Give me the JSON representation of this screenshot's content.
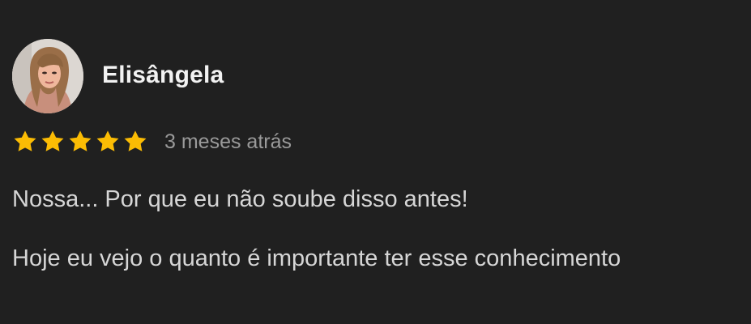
{
  "review": {
    "author_name": "Elisângela",
    "rating": 5,
    "max_rating": 5,
    "time_ago": "3 meses atrás",
    "paragraphs": [
      "Nossa... Por que eu não soube disso antes!",
      "Hoje eu vejo o quanto é importante ter esse conhecimento"
    ]
  },
  "colors": {
    "background": "#202020",
    "star": "#fbbc04",
    "name": "#f2f2f2",
    "time": "#9a9a9a",
    "text": "#d6d6d6"
  },
  "icons": {
    "avatar": "user-photo",
    "star": "star-icon"
  }
}
